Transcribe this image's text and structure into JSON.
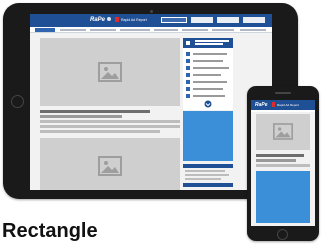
{
  "caption": "Rectangle",
  "tablet_screen": {
    "logo": "RaPe",
    "brand": "Rapid Ad Report"
  },
  "phone_screen": {
    "logo": "RaPe",
    "brand": "Rapid Ad Report"
  },
  "icons": {
    "image_placeholder": "image-icon",
    "chevron": "chevron-down-icon"
  },
  "colors": {
    "nav_blue": "#1f4f95",
    "ad_blue": "#3a8fd8",
    "accent_red": "#e02b2b",
    "placeholder_gray": "#cfcfcf",
    "device_black": "#1a1a1a"
  }
}
